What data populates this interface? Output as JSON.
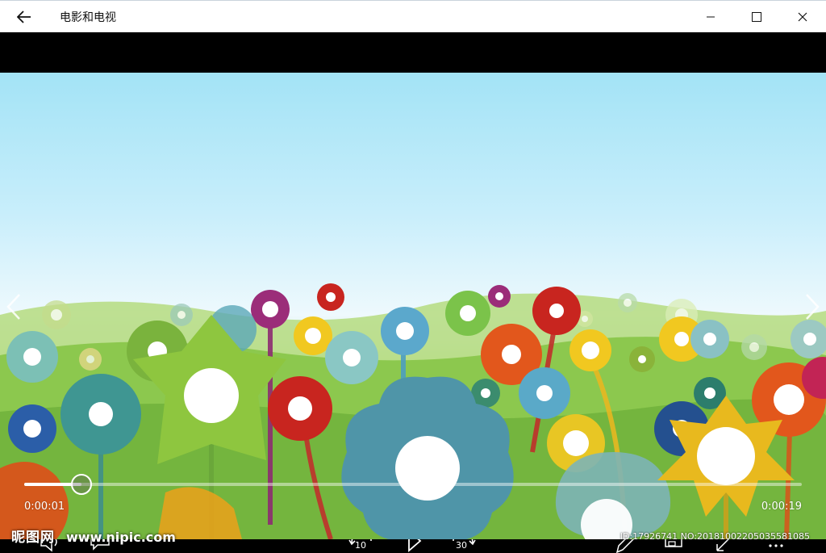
{
  "window": {
    "title": "电影和电视",
    "back_icon": "arrow-left-icon",
    "minimize_icon": "minimize-icon",
    "maximize_icon": "maximize-icon",
    "close_icon": "close-icon"
  },
  "player": {
    "current_time": "0:00:01",
    "total_time": "0:00:19",
    "progress": 0.074,
    "prev_icon": "chevron-left-icon",
    "next_icon": "chevron-right-icon"
  },
  "controls": {
    "volume_icon": "volume-icon",
    "subtitles_icon": "subtitles-icon",
    "skip_back_label": "10",
    "skip_back_icon": "skip-back-icon",
    "play_icon": "play-icon",
    "skip_forward_label": "30",
    "skip_forward_icon": "skip-forward-icon",
    "edit_icon": "pencil-icon",
    "cast_icon": "cast-icon",
    "fullscreen_icon": "fullscreen-icon",
    "more_icon": "more-icon"
  },
  "watermark": {
    "logo_text": "昵图网",
    "url": "www.nipic.com",
    "id_text": "ID:17926741 NO:20181002205035581085"
  },
  "colors": {
    "sky_top": "#a3e3f6",
    "grass": "#7fc24a",
    "accent_white": "#ffffff"
  }
}
